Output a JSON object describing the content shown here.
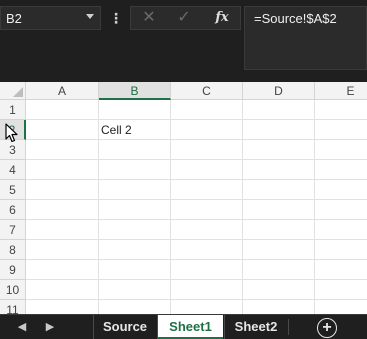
{
  "formula_bar": {
    "name_box": "B2",
    "formula": "=Source!$A$2",
    "fx_label": "fx"
  },
  "grid": {
    "columns": [
      "A",
      "B",
      "C",
      "D",
      "E"
    ],
    "rows": [
      "1",
      "2",
      "3",
      "4",
      "5",
      "6",
      "7",
      "8",
      "9",
      "10",
      "11"
    ],
    "cell_b2": "Cell 2"
  },
  "sheet_tabs": [
    {
      "label": "Source",
      "active": false
    },
    {
      "label": "Sheet1",
      "active": true
    },
    {
      "label": "Sheet2",
      "active": false
    }
  ],
  "colors": {
    "accent": "#1e7145",
    "chrome_bg": "#1f1f1f",
    "header_bg": "#f3f3f3"
  }
}
